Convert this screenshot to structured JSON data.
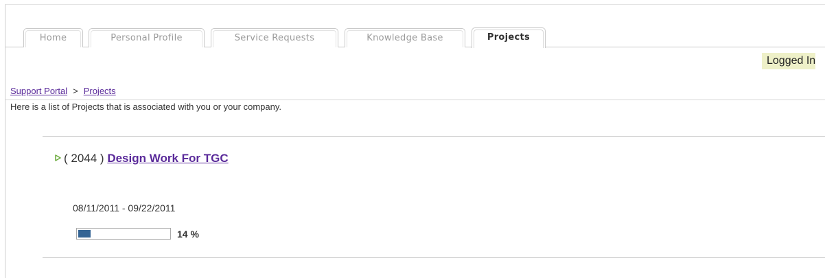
{
  "tabs": [
    {
      "label": "Home",
      "active": false
    },
    {
      "label": "Personal Profile",
      "active": false
    },
    {
      "label": "Service Requests",
      "active": false
    },
    {
      "label": "Knowledge Base",
      "active": false
    },
    {
      "label": "Projects",
      "active": true
    }
  ],
  "header": {
    "logged_in_text": "Logged In"
  },
  "breadcrumb": {
    "items": [
      "Support Portal",
      "Projects"
    ],
    "separator": ">"
  },
  "intro_text": "Here is a list of Projects that is associated with you or your company.",
  "projects": [
    {
      "id_text": "( 2044 )",
      "title": "Design Work For TGC",
      "date_range": "08/11/2011 - 09/22/2011",
      "progress_percent": 14,
      "progress_label": "14 %",
      "expand_icon": "play-triangle-icon"
    }
  ],
  "colors": {
    "link": "#5a2a9a",
    "progress_fill": "#346494",
    "expand_icon": "#6aaa3a",
    "logged_in_highlight": "#eef0c8"
  }
}
